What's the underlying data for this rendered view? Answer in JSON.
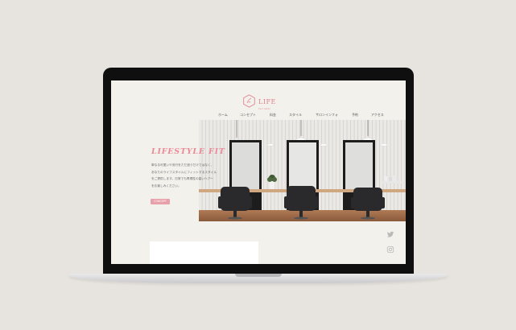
{
  "brand": {
    "name": "LIFE",
    "tagline": "hair salon",
    "color": "#e07f8c"
  },
  "nav": {
    "items": [
      {
        "label": "ホーム"
      },
      {
        "label": "コンセプト"
      },
      {
        "label": "料金"
      },
      {
        "label": "スタイル"
      },
      {
        "label": "サロンインフォ"
      },
      {
        "label": "予約"
      },
      {
        "label": "アクセス"
      }
    ]
  },
  "hero": {
    "title": "LIFESTYLE FIT",
    "lines": [
      "単なる可愛いや流行をただ追うだけではなく、",
      "あなたのライフスタイルにフィットするスタイル",
      "をご提供します。日常でも再現性の高いヘアー",
      "をお楽しみください。"
    ],
    "button_label": "CONCEPT",
    "accent_color": "#ea8a98"
  },
  "social": {
    "icons": [
      "twitter-icon",
      "instagram-icon"
    ]
  }
}
